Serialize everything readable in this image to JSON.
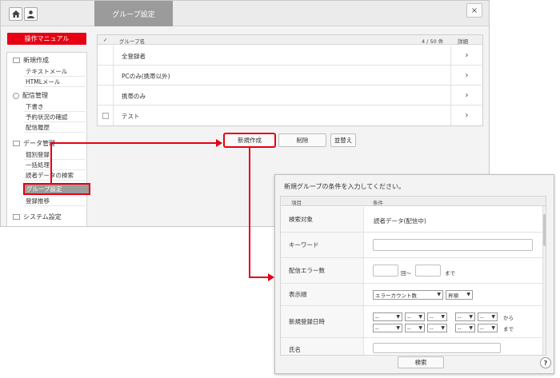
{
  "tab_title": "グループ設定",
  "close_label": "×",
  "manual_button": "操作マニュアル",
  "sidebar": {
    "sections": [
      {
        "label": "新規作成",
        "items": [
          "テキストメール",
          "HTMLメール"
        ]
      },
      {
        "label": "配信管理",
        "items": [
          "下書き",
          "予約状況の確認",
          "配信履歴"
        ]
      },
      {
        "label": "データ管理",
        "items": [
          "個別登録",
          "一括処理",
          "読者データの検索",
          "グループ設定",
          "登録推移"
        ]
      },
      {
        "label": "システム設定",
        "items": []
      }
    ],
    "active_item": "グループ設定"
  },
  "grouplist": {
    "check_header": "✓",
    "name_header": "グループ名",
    "count": "4 / 50 件",
    "detail_header": "詳細",
    "rows": [
      {
        "name": "全登録者",
        "checkbox": false
      },
      {
        "name": "PCのみ(携帯以外)",
        "checkbox": false
      },
      {
        "name": "携帯のみ",
        "checkbox": false
      },
      {
        "name": "テスト",
        "checkbox": true
      }
    ],
    "arrow": "›"
  },
  "actions": {
    "new": "新規作成",
    "delete": "削除",
    "sort": "並替え"
  },
  "dialog": {
    "title": "新規グループの条件を入力してください。",
    "col_item": "項目",
    "col_cond": "条件",
    "rows": {
      "target_label": "検索対象",
      "target_value": "読者データ(配信中)",
      "keyword_label": "キーワード",
      "error_label": "配信エラー数",
      "error_unit_from": "回～",
      "error_unit_to": "まで",
      "order_label": "表示順",
      "order_field": "エラーカウント数",
      "order_dir": "昇順",
      "date_label": "新規登録日時",
      "date_placeholder": "--",
      "date_from": "から",
      "date_to": "まで",
      "name_label": "氏名"
    },
    "search_button": "検索",
    "help": "?"
  },
  "colors": {
    "accent": "#e60012",
    "tab": "#9b9b9b",
    "active_item": "#9c9c9c"
  }
}
